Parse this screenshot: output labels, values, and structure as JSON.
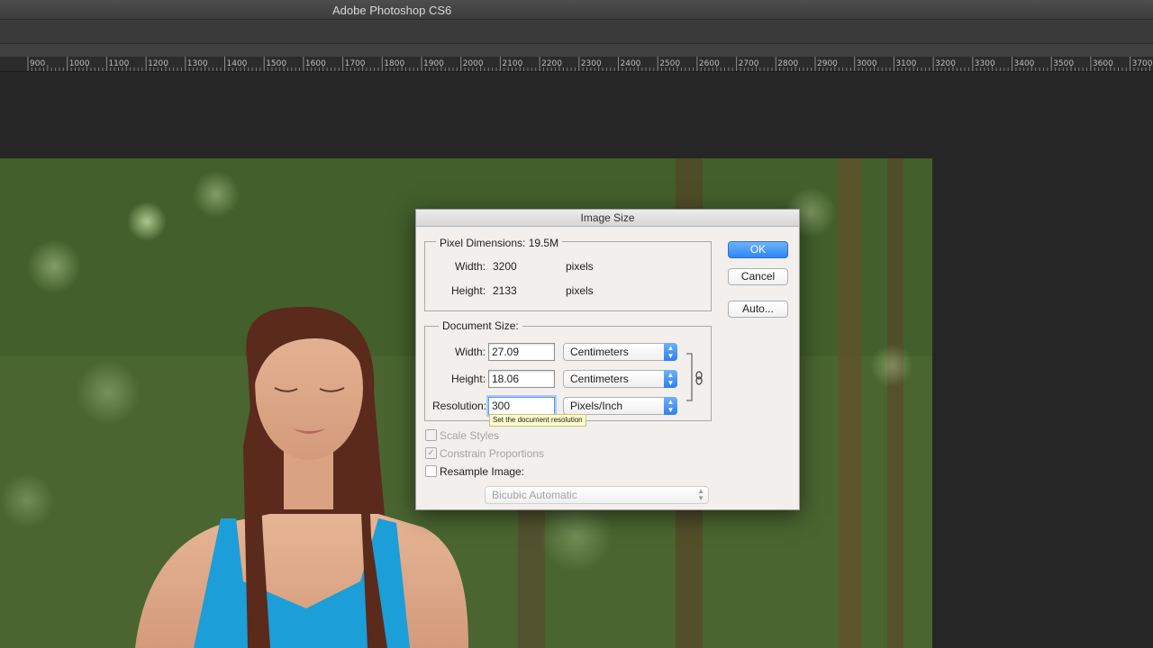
{
  "app": {
    "title": "Adobe Photoshop CS6"
  },
  "ruler": {
    "labels": [
      "900",
      "1000",
      "1100",
      "1200",
      "1300",
      "1400",
      "1500",
      "1600",
      "1700",
      "1800",
      "1900",
      "2000",
      "2100",
      "2200",
      "2300",
      "2400",
      "2500",
      "2600",
      "2700",
      "2800",
      "2900",
      "3000",
      "3100",
      "3200",
      "3300",
      "3400",
      "3500",
      "3600",
      "3700"
    ]
  },
  "dialog": {
    "title": "Image Size",
    "pixel_dimensions": {
      "label": "Pixel Dimensions:",
      "size": "19.5M",
      "width_label": "Width:",
      "width_value": "3200",
      "width_unit": "pixels",
      "height_label": "Height:",
      "height_value": "2133",
      "height_unit": "pixels"
    },
    "document_size": {
      "label": "Document Size:",
      "width_label": "Width:",
      "width_value": "27.09",
      "width_unit": "Centimeters",
      "height_label": "Height:",
      "height_value": "18.06",
      "height_unit": "Centimeters",
      "resolution_label": "Resolution:",
      "resolution_value": "300",
      "resolution_unit": "Pixels/Inch"
    },
    "tooltip": "Set the document resolution",
    "options": {
      "scale_styles": "Scale Styles",
      "constrain_proportions": "Constrain Proportions",
      "resample_image": "Resample Image:",
      "resample_method": "Bicubic Automatic"
    },
    "buttons": {
      "ok": "OK",
      "cancel": "Cancel",
      "auto": "Auto..."
    }
  },
  "colors": {
    "accent": "#2f86f5",
    "dialog_bg": "#f3efed",
    "app_bg": "#262626"
  }
}
